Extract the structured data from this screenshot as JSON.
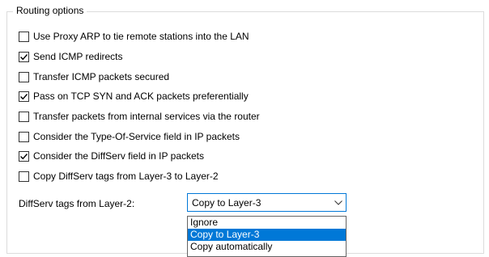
{
  "group": {
    "title": "Routing options"
  },
  "checkboxes": [
    {
      "label": "Use Proxy ARP to tie remote stations into the LAN",
      "checked": false
    },
    {
      "label": "Send ICMP redirects",
      "checked": true
    },
    {
      "label": "Transfer ICMP packets secured",
      "checked": false
    },
    {
      "label": "Pass on TCP SYN and ACK packets preferentially",
      "checked": true
    },
    {
      "label": "Transfer packets from internal services via the router",
      "checked": false
    },
    {
      "label": "Consider the Type-Of-Service field in IP packets",
      "checked": false
    },
    {
      "label": "Consider the DiffServ field in IP packets",
      "checked": true
    },
    {
      "label": "Copy DiffServ tags from Layer-3 to Layer-2",
      "checked": false
    }
  ],
  "diffserv": {
    "label": "DiffServ tags from Layer-2:",
    "selected": "Copy to Layer-3",
    "options": [
      "Ignore",
      "Copy to Layer-3",
      "Copy automatically"
    ],
    "highlighted_index": 1
  },
  "colors": {
    "accent": "#0078d7",
    "group_border": "#dcdcdc"
  }
}
